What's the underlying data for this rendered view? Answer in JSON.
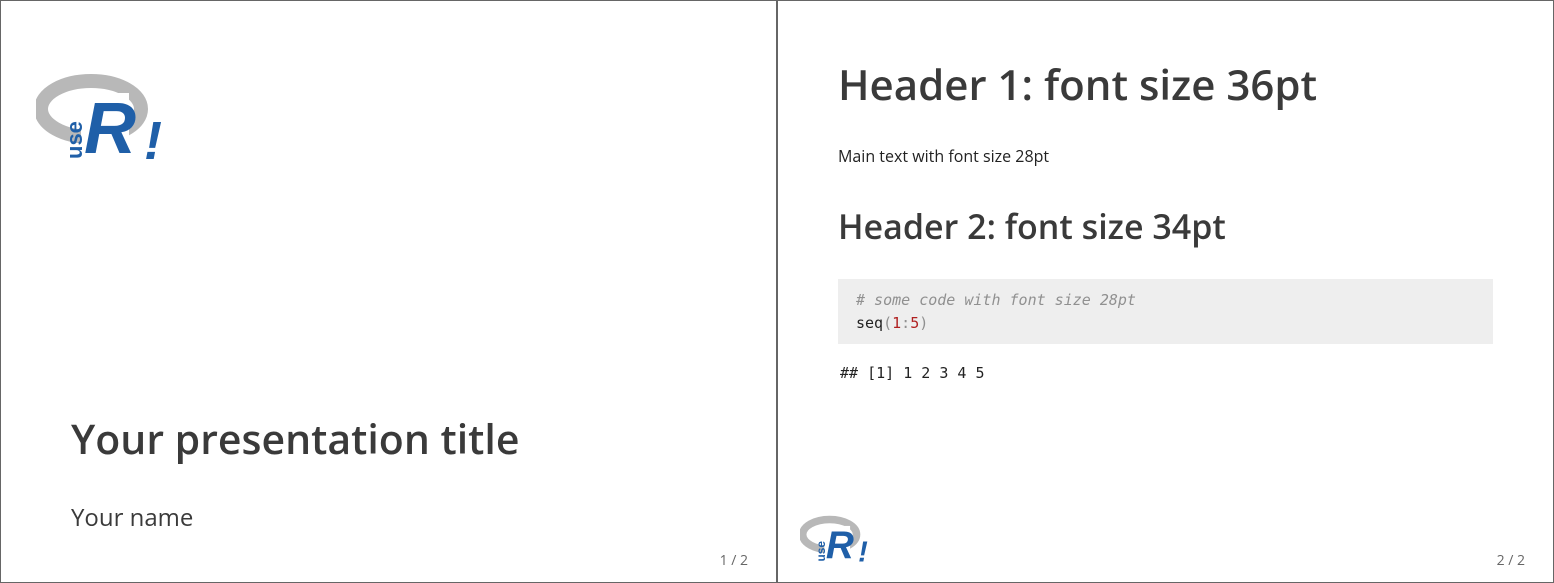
{
  "slide1": {
    "title": "Your presentation title",
    "author": "Your name",
    "pagenum": "1 / 2"
  },
  "slide2": {
    "h1": "Header 1: font size 36pt",
    "bodytext": "Main text with font size 28pt",
    "h2": "Header 2: font size 34pt",
    "code_comment": "# some code with font size 28pt",
    "code_fn": "seq",
    "code_open": "(",
    "code_num1": "1",
    "code_colon": ":",
    "code_num2": "5",
    "code_close": ")",
    "output": "## [1] 1 2 3 4 5",
    "pagenum": "2 / 2"
  },
  "logo": {
    "name": "useR!"
  }
}
